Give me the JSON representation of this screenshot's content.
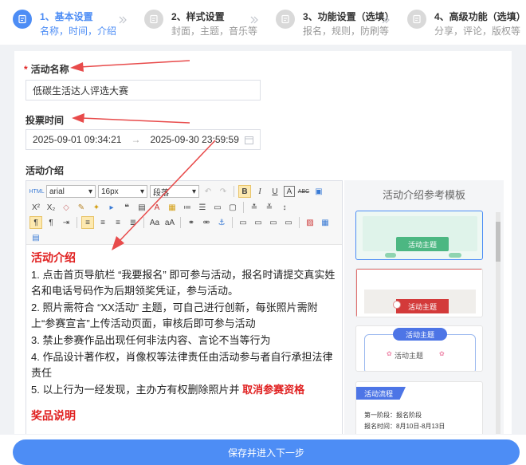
{
  "steps": [
    {
      "title": "1、基本设置",
      "sub": "名称，时间，介绍"
    },
    {
      "title": "2、样式设置",
      "sub": "封面，主题，音乐等"
    },
    {
      "title": "3、功能设置（选填）",
      "sub": "报名，规则，防刷等"
    },
    {
      "title": "4、高级功能（选填）",
      "sub": "分享，评论，版权等"
    }
  ],
  "form": {
    "name_label": "活动名称",
    "name_value": "低碳生活达人评选大赛",
    "vote_time_label": "投票时间",
    "start_time": "2025-09-01 09:34:21",
    "range_arrow": "→",
    "end_time": "2025-09-30 23:59:59",
    "intro_label": "活动介绍"
  },
  "toolbar": {
    "font": "arial",
    "size": "16px",
    "paragraph": "段落"
  },
  "content": {
    "heading": "活动介绍",
    "items": [
      "1. 点击首页导航栏 “我要报名” 即可参与活动，报名时请提交真实姓名和电话号码作为后期领奖凭证，参与活动。",
      "2. 照片需符合 “XX活动” 主题，可自己进行创新，每张照片需附上“参赛宣言”上传活动页面，审核后即可参与活动",
      "3. 禁止参赛作品出现任何非法内容、言论不当等行为",
      "4. 作品设计著作权，肖像权等法律责任由活动参与者自行承担法律责任"
    ],
    "item5_prefix": "5. 以上行为一经发现，主办方有权删除照片并 ",
    "item5_red": "取消参赛资格",
    "next_heading": "奖品说明"
  },
  "templates": {
    "title": "活动介绍参考模板",
    "t1_label": "活动主题",
    "t2_label": "活动主题",
    "t3_label": "活动主题",
    "t3_sub": "活动主题",
    "t4_tag": "活动流程",
    "t4_line1": "第一阶段：报名阶段",
    "t4_line2": "报名时间：8月10日-8月13日"
  },
  "footer": {
    "save_label": "保存并进入下一步"
  },
  "colors": {
    "primary": "#4d8df5",
    "required": "#e02020",
    "annotation_arrow": "#e84b4b"
  }
}
